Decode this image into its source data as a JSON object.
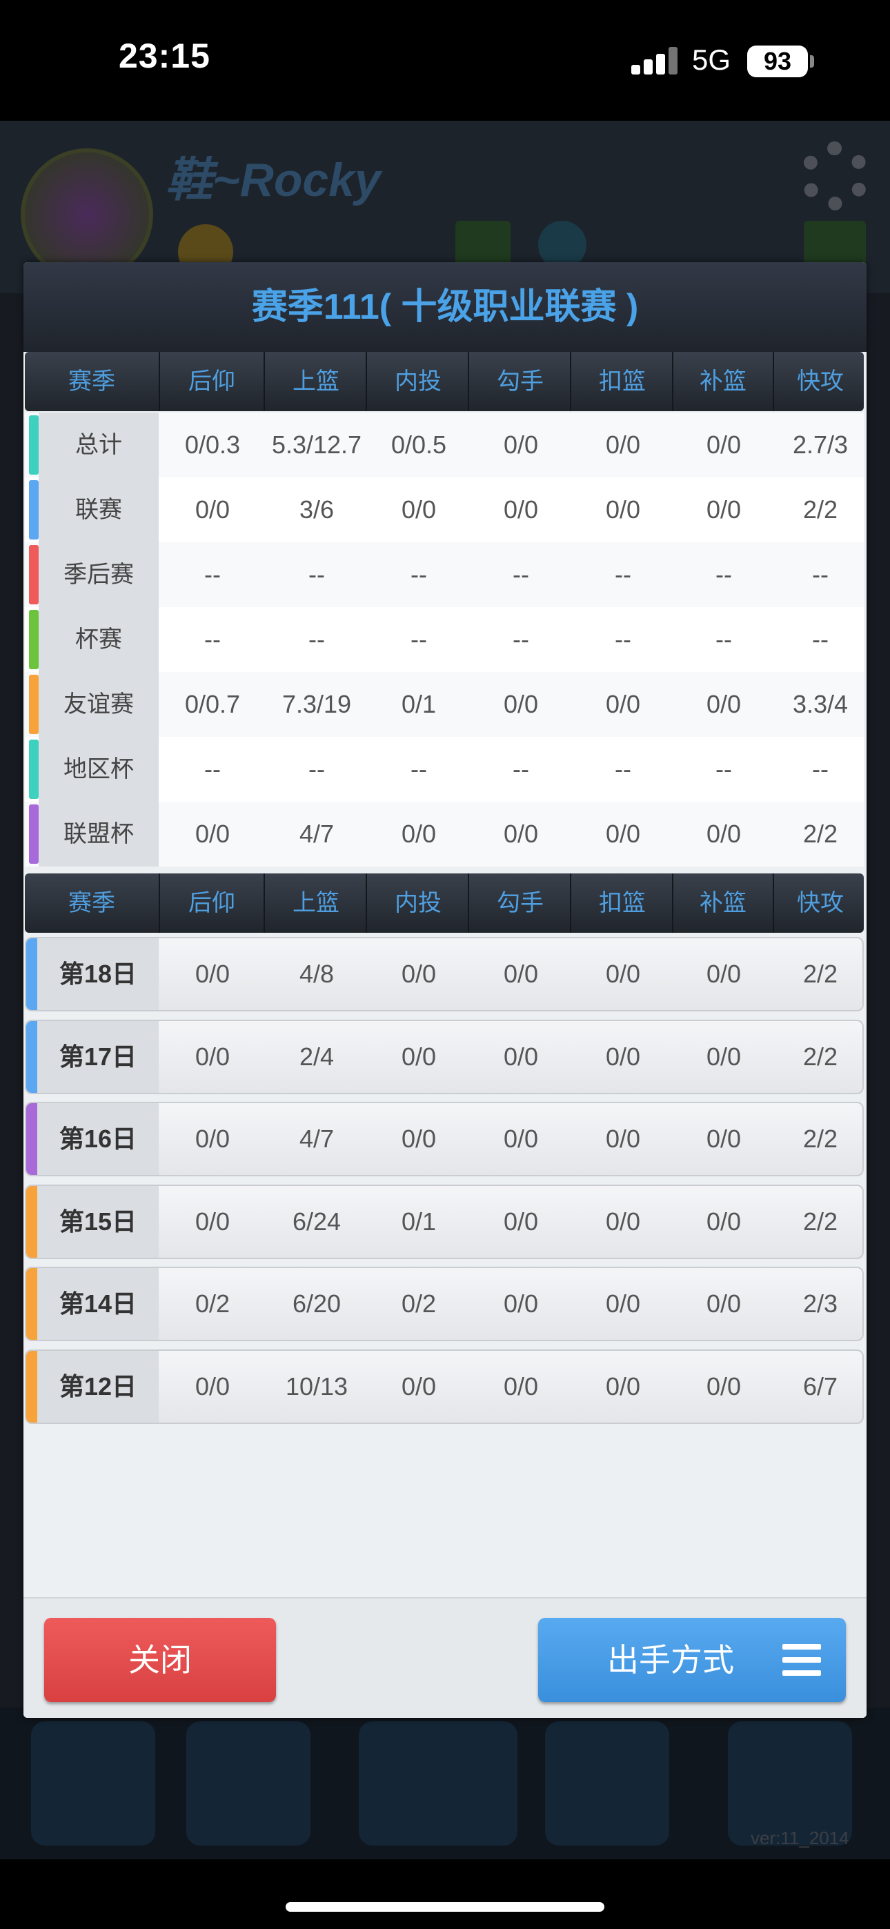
{
  "status_bar": {
    "time": "23:15",
    "network": "5G",
    "battery": "93"
  },
  "background": {
    "player_name": "鞋~Rocky",
    "version": "ver:11_2014"
  },
  "dialog": {
    "title": "赛季111( 十级职业联赛 )",
    "columns": [
      "赛季",
      "后仰",
      "上篮",
      "内投",
      "勾手",
      "扣篮",
      "补篮",
      "快攻"
    ],
    "season_rows": [
      {
        "label": "总计",
        "color": "#3fd1c0",
        "values": [
          "0/0.3",
          "5.3/12.7",
          "0/0.5",
          "0/0",
          "0/0",
          "0/0",
          "2.7/3"
        ]
      },
      {
        "label": "联赛",
        "color": "#5ba7f2",
        "values": [
          "0/0",
          "3/6",
          "0/0",
          "0/0",
          "0/0",
          "0/0",
          "2/2"
        ]
      },
      {
        "label": "季后赛",
        "color": "#ef5b5b",
        "values": [
          "--",
          "--",
          "--",
          "--",
          "--",
          "--",
          "--"
        ]
      },
      {
        "label": "杯赛",
        "color": "#6cc33c",
        "values": [
          "--",
          "--",
          "--",
          "--",
          "--",
          "--",
          "--"
        ]
      },
      {
        "label": "友谊赛",
        "color": "#f7a23a",
        "values": [
          "0/0.7",
          "7.3/19",
          "0/1",
          "0/0",
          "0/0",
          "0/0",
          "3.3/4"
        ]
      },
      {
        "label": "地区杯",
        "color": "#3fd1c0",
        "values": [
          "--",
          "--",
          "--",
          "--",
          "--",
          "--",
          "--"
        ]
      },
      {
        "label": "联盟杯",
        "color": "#a86ad8",
        "values": [
          "0/0",
          "4/7",
          "0/0",
          "0/0",
          "0/0",
          "0/0",
          "2/2"
        ]
      }
    ],
    "day_rows": [
      {
        "label": "第18日",
        "color": "#5ba7f2",
        "values": [
          "0/0",
          "4/8",
          "0/0",
          "0/0",
          "0/0",
          "0/0",
          "2/2"
        ]
      },
      {
        "label": "第17日",
        "color": "#5ba7f2",
        "values": [
          "0/0",
          "2/4",
          "0/0",
          "0/0",
          "0/0",
          "0/0",
          "2/2"
        ]
      },
      {
        "label": "第16日",
        "color": "#a86ad8",
        "values": [
          "0/0",
          "4/7",
          "0/0",
          "0/0",
          "0/0",
          "0/0",
          "2/2"
        ]
      },
      {
        "label": "第15日",
        "color": "#f7a23a",
        "values": [
          "0/0",
          "6/24",
          "0/1",
          "0/0",
          "0/0",
          "0/0",
          "2/2"
        ]
      },
      {
        "label": "第14日",
        "color": "#f7a23a",
        "values": [
          "0/2",
          "6/20",
          "0/2",
          "0/0",
          "0/0",
          "0/0",
          "2/3"
        ]
      },
      {
        "label": "第12日",
        "color": "#f7a23a",
        "values": [
          "0/0",
          "10/13",
          "0/0",
          "0/0",
          "0/0",
          "0/0",
          "6/7"
        ]
      }
    ],
    "close_label": "关闭",
    "shot_type_label": "出手方式",
    "shot_type_icon": "menu-icon"
  }
}
